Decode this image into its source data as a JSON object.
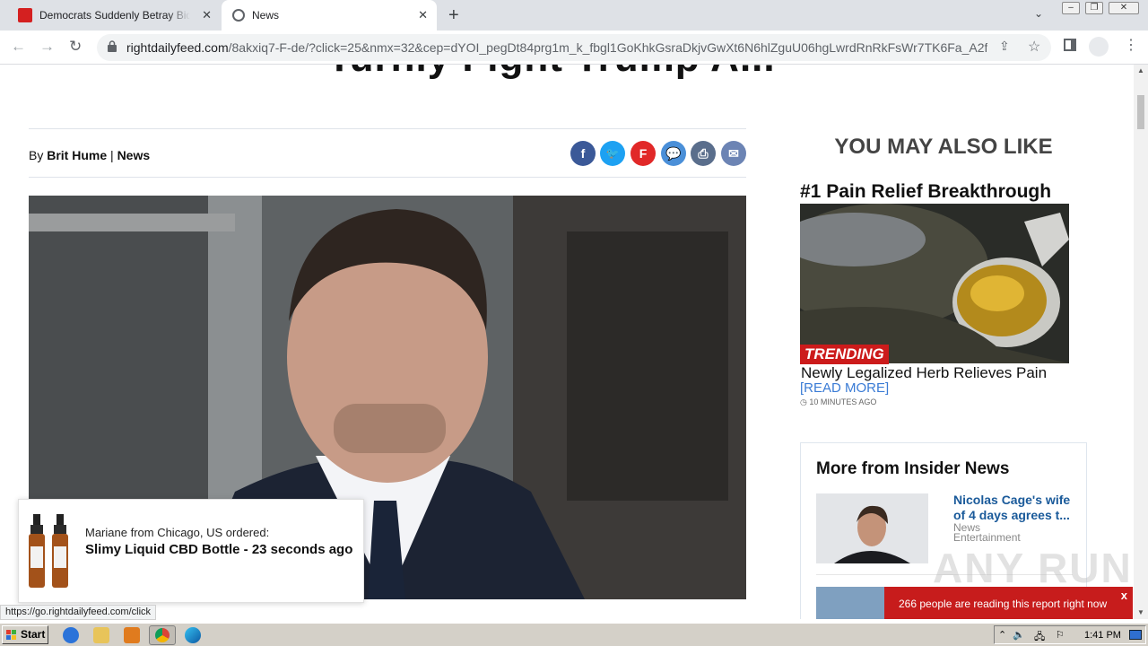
{
  "browser": {
    "tabs": [
      {
        "title": "Democrats Suddenly Betray Biden ov",
        "active": false
      },
      {
        "title": "News",
        "active": true
      }
    ],
    "url_host": "rightdailyfeed.com",
    "url_path": "/8akxiq7-F-de/?click=25&nmx=32&cep=dYOI_pegDt84prg1m_k_fbgl1GoKhkGsraDkjvGwXt6N6hlZguU06hgLwrdRnRkFsWr7TK6Fa_A2f...",
    "status_url": "https://go.rightdailyfeed.com/click"
  },
  "article": {
    "headline_fragment": "Turnly Fight Trump A...",
    "by_prefix": "By ",
    "author": "Brit Hume",
    "separator": " | ",
    "category": "News",
    "share_buttons": [
      "facebook",
      "twitter",
      "flipboard",
      "comment",
      "print",
      "email"
    ]
  },
  "sidebar": {
    "heading": "YOU MAY ALSO LIKE",
    "promo": {
      "title": "#1 Pain Relief Breakthrough",
      "badge": "TRENDING",
      "subtitle": "Newly Legalized Herb Relieves Pain",
      "link": "[READ MORE]",
      "time": "10 MINUTES AGO"
    },
    "insider": {
      "title": "More from Insider News",
      "headline": "Nicolas Cage's wife of 4 days agrees t...",
      "category": "News Entertainment"
    }
  },
  "popup": {
    "who": "Mariane from Chicago, US ordered:",
    "what": "Slimy Liquid CBD Bottle - 23 seconds ago"
  },
  "notice": {
    "text": "266 people are reading this report right now",
    "close": "x"
  },
  "watermark": "ANY RUN",
  "taskbar": {
    "start": "Start",
    "clock": "1:41 PM"
  },
  "colors": {
    "facebook": "#3b5998",
    "twitter": "#1da1f2",
    "flipboard": "#e12828",
    "comment": "#4a8fd8",
    "print": "#5a6e8c",
    "email": "#6c84b4",
    "trending": "#cc1b1b",
    "notice": "#c71c1c"
  }
}
